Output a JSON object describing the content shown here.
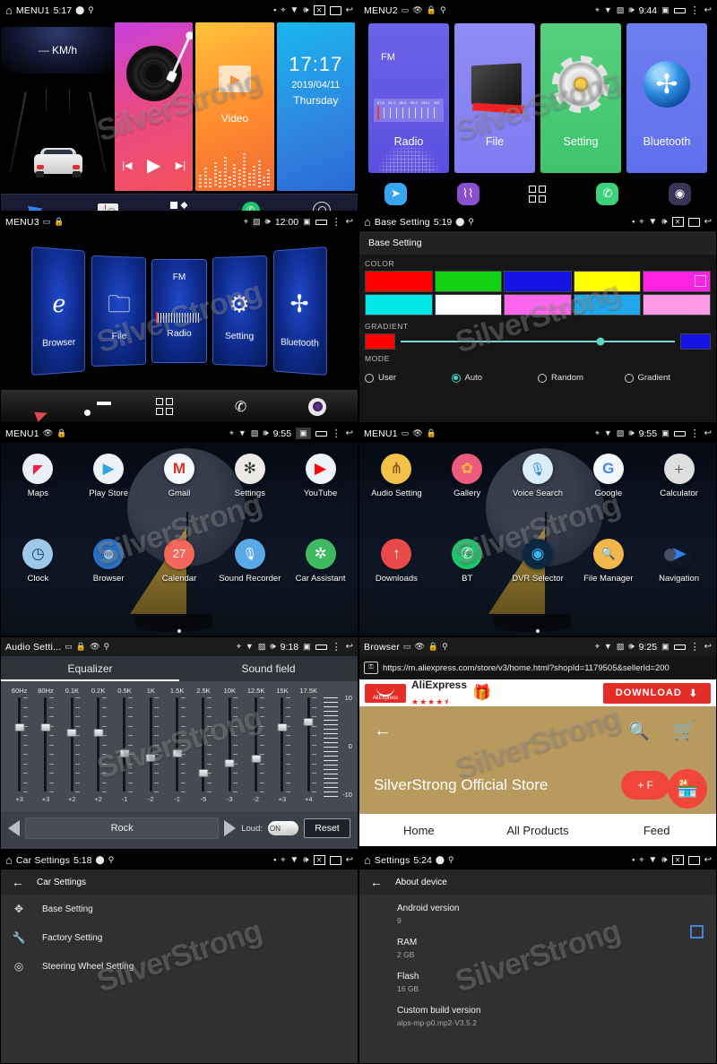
{
  "panels": {
    "p1": {
      "status": {
        "title": "MENU1",
        "clock": "5:17"
      },
      "hud": {
        "speed": "—",
        "unit": "KM/h"
      },
      "tiles": {
        "video_label": "Video",
        "clock_time": "17:17",
        "clock_date": "2019/04/11",
        "clock_day": "Thursday"
      },
      "dock": [
        "navigation",
        "radio",
        "apps",
        "phone",
        "settings"
      ]
    },
    "p2": {
      "status": {
        "title": "MENU2",
        "clock": "9:44"
      },
      "tiles": [
        {
          "label": "Radio",
          "sub": "FM",
          "freqs": [
            "87.5",
            "91.4",
            "95.3",
            "99.2",
            "103.1",
            "107"
          ]
        },
        {
          "label": "File"
        },
        {
          "label": "Setting"
        },
        {
          "label": "Bluetooth"
        }
      ],
      "dock": [
        "navigation",
        "music",
        "apps",
        "phone",
        "dvr"
      ]
    },
    "p3": {
      "status": {
        "title": "MENU3",
        "clock": "12:00"
      },
      "cards": [
        {
          "label": "Browser"
        },
        {
          "label": "File"
        },
        {
          "label": "Radio",
          "sub": "FM"
        },
        {
          "label": "Setting"
        },
        {
          "label": "Bluetooth"
        }
      ],
      "dock": [
        "navigation",
        "radio",
        "apps",
        "bt-phone",
        "camera"
      ]
    },
    "p4": {
      "status": {
        "title": "Base Setting",
        "clock": "5:19"
      },
      "page_title": "Base Setting",
      "sections": {
        "color": "COLOR",
        "gradient": "GRADIENT",
        "mode": "MODE"
      },
      "colors_row1": [
        "#ff0000",
        "#12d012",
        "#1414e6",
        "#ffff00",
        "#ff22e0"
      ],
      "colors_row2": [
        "#00e8e8",
        "#ffffff",
        "#ff66ee",
        "#20a8ea",
        "#ff9ae8"
      ],
      "gradient_from": "#ff0000",
      "gradient_to": "#1414e6",
      "gradient_pos_percent": 73,
      "modes": [
        {
          "label": "User",
          "selected": false
        },
        {
          "label": "Auto",
          "selected": true
        },
        {
          "label": "Random",
          "selected": false
        },
        {
          "label": "Gradient",
          "selected": false
        }
      ]
    },
    "p5": {
      "status": {
        "title": "MENU1",
        "clock": "9:55"
      },
      "apps": [
        {
          "label": "Maps",
          "icon": "maps-icon",
          "bg": "#eaf1f7",
          "glyph": "◤"
        },
        {
          "label": "Play Store",
          "icon": "play-store-icon",
          "bg": "#eef2f6",
          "glyph": "▶"
        },
        {
          "label": "Gmail",
          "icon": "gmail-icon",
          "bg": "#f4f8fb",
          "glyph": "M"
        },
        {
          "label": "Settings",
          "icon": "settings-icon",
          "bg": "#eceae4",
          "glyph": "✻"
        },
        {
          "label": "YouTube",
          "icon": "youtube-icon",
          "bg": "#f2f6fa",
          "glyph": "▶"
        },
        {
          "label": "Clock",
          "icon": "clock-icon",
          "bg": "#b9d8ef",
          "glyph": "◷"
        },
        {
          "label": "Browser",
          "icon": "browser-icon",
          "bg": "#2a6fbf",
          "glyph": "🌐"
        },
        {
          "label": "Calendar",
          "icon": "calendar-icon",
          "bg": "#f2685c",
          "glyph": "27"
        },
        {
          "label": "Sound Recorder",
          "icon": "sound-recorder-icon",
          "bg": "#5aa9e6",
          "glyph": "🎤"
        },
        {
          "label": "Car Assistant",
          "icon": "car-assistant-icon",
          "bg": "#3fba63",
          "glyph": "✲"
        }
      ]
    },
    "p6": {
      "status": {
        "title": "MENU1",
        "clock": "9:55"
      },
      "apps": [
        {
          "label": "Audio Setting",
          "icon": "audio-setting-icon",
          "bg": "#f2c24a",
          "glyph": "⋔"
        },
        {
          "label": "Gallery",
          "icon": "gallery-icon",
          "bg": "#ec5b7b",
          "glyph": "✿"
        },
        {
          "label": "Voice Search",
          "icon": "voice-search-icon",
          "bg": "#5aa9e6",
          "glyph": "🎤"
        },
        {
          "label": "Google",
          "icon": "google-icon",
          "bg": "#f4f7fa",
          "glyph": "G"
        },
        {
          "label": "Calculator",
          "icon": "calculator-icon",
          "bg": "#dedede",
          "glyph": "÷"
        },
        {
          "label": "Downloads",
          "icon": "downloads-icon",
          "bg": "#e84a4a",
          "glyph": "↑"
        },
        {
          "label": "BT",
          "icon": "bt-icon",
          "bg": "#1ec36a",
          "glyph": "✆"
        },
        {
          "label": "DVR Selector",
          "icon": "dvr-selector-icon",
          "bg": "#0e2740",
          "glyph": "◉"
        },
        {
          "label": "File Manager",
          "icon": "file-manager-icon",
          "bg": "#f0b84a",
          "glyph": "🔍"
        },
        {
          "label": "Navigation",
          "icon": "navigation-icon",
          "bg": "transparent",
          "glyph": "➤"
        }
      ]
    },
    "p7": {
      "status": {
        "title": "Audio Setti...",
        "clock": "9:18"
      },
      "tabs": [
        {
          "label": "Equalizer",
          "active": true
        },
        {
          "label": "Sound field",
          "active": false
        }
      ],
      "preset": "Rock",
      "loud_label": "Loud:",
      "loud_value": "ON",
      "reset_label": "Reset",
      "scale_labels": [
        "10",
        "0",
        "-10"
      ]
    },
    "p8": {
      "status": {
        "title": "Browser",
        "clock": "9:25"
      },
      "url": "https://m.aliexpress.com/store/v3/home.html?shopId=1179505&sellerId=200",
      "banner": {
        "brand": "AliExpress",
        "stars": "★★★★⯨",
        "download_label": "DOWNLOAD"
      },
      "store_name": "SilverStrong Official Store",
      "follow_label": "+ F",
      "nav": [
        "Home",
        "All Products",
        "Feed"
      ]
    },
    "p9": {
      "status": {
        "title": "Car Settings",
        "clock": "5:18"
      },
      "header": "Car Settings",
      "items": [
        {
          "label": "Base Setting",
          "icon": "base-setting-icon",
          "glyph": "✥"
        },
        {
          "label": "Factory Setting",
          "icon": "wrench-icon",
          "glyph": "🔧"
        },
        {
          "label": "Steering Wheel Setting",
          "icon": "steering-wheel-icon",
          "glyph": "◎"
        }
      ]
    },
    "p10": {
      "status": {
        "title": "Settings",
        "clock": "5:24"
      },
      "header": "About device",
      "items": [
        {
          "key": "Android version",
          "value": "9"
        },
        {
          "key": "RAM",
          "value": "2 GB"
        },
        {
          "key": "Flash",
          "value": "16 GB"
        },
        {
          "key": "Custom build version",
          "value": "alps-mp-p0.mp2-V3.5.2"
        }
      ]
    }
  },
  "watermark": "SilverStrong",
  "eq_bands": [
    {
      "freq": "60Hz",
      "value": "+3",
      "pos": 28
    },
    {
      "freq": "80Hz",
      "value": "+3",
      "pos": 28
    },
    {
      "freq": "0.1K",
      "value": "+2",
      "pos": 33
    },
    {
      "freq": "0.2K",
      "value": "+2",
      "pos": 33
    },
    {
      "freq": "0.5K",
      "value": "-1",
      "pos": 55
    },
    {
      "freq": "1K",
      "value": "-2",
      "pos": 60
    },
    {
      "freq": "1.5K",
      "value": "-1",
      "pos": 55
    },
    {
      "freq": "2.5K",
      "value": "-5",
      "pos": 76
    },
    {
      "freq": "10K",
      "value": "-3",
      "pos": 66
    },
    {
      "freq": "12.5K",
      "value": "-2",
      "pos": 61
    },
    {
      "freq": "15K",
      "value": "+3",
      "pos": 28
    },
    {
      "freq": "17.5K",
      "value": "+4",
      "pos": 22
    }
  ]
}
